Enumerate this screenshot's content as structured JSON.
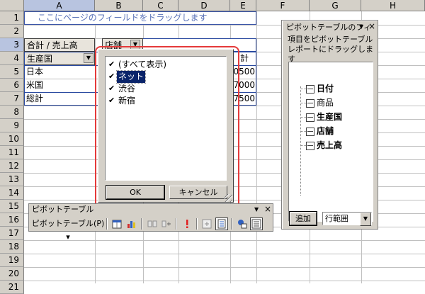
{
  "columns": [
    "A",
    "B",
    "C",
    "D",
    "E",
    "F",
    "G",
    "H"
  ],
  "rows": [
    "1",
    "2",
    "3",
    "4",
    "5",
    "6",
    "7",
    "8",
    "9",
    "10",
    "11",
    "12",
    "13",
    "14",
    "15",
    "16",
    "17",
    "18",
    "19",
    "20",
    "21"
  ],
  "drop_zone_text": "ここにページのフィールドをドラッグします",
  "pivot": {
    "data_field": "合計 / 売上高",
    "col_field": "店舗",
    "row_field": "生産国",
    "total_header": "計",
    "row_labels": [
      "日本",
      "米国",
      "総計"
    ],
    "visible_values": [
      "0500",
      "7000",
      "7500"
    ]
  },
  "filter_dropdown": {
    "items": [
      {
        "label": "(すべて表示)",
        "checked": true,
        "selected": false
      },
      {
        "label": "ネット",
        "checked": true,
        "selected": true
      },
      {
        "label": "渋谷",
        "checked": true,
        "selected": false
      },
      {
        "label": "新宿",
        "checked": true,
        "selected": false
      }
    ],
    "ok_label": "OK",
    "cancel_label": "キャンセル"
  },
  "field_list": {
    "title": "ピボットテーブルのフィ",
    "title_dropdown": "▼",
    "close": "×",
    "description": "項目をピボットテーブル レポートにドラッグします",
    "fields": [
      {
        "label": "日付",
        "bold": true
      },
      {
        "label": "商品",
        "bold": false
      },
      {
        "label": "生産国",
        "bold": true
      },
      {
        "label": "店舗",
        "bold": true
      },
      {
        "label": "売上高",
        "bold": true
      }
    ],
    "add_button": "追加",
    "area_select": "行範囲",
    "area_arrow": "▼"
  },
  "toolbar": {
    "title": "ピボットテーブル",
    "menu_button": "ピボットテーブル(P) ▾",
    "title_dropdown": "▼",
    "close": "×"
  },
  "colors": {
    "highlight_border": "#e53a3a",
    "selection": "#0a246a",
    "pivot_border": "#2a4aa0"
  }
}
